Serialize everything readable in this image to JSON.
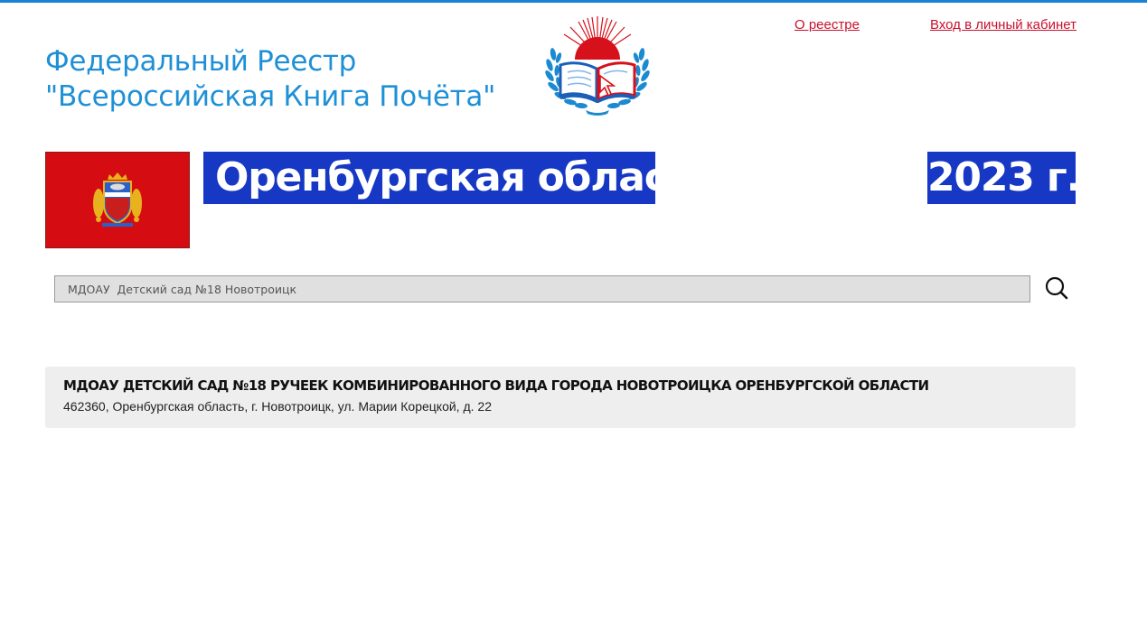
{
  "header": {
    "title_line1": "Федеральный Реестр",
    "title_line2": "\"Всероссийская Книга Почёта\"",
    "nav": {
      "about_label": "О реестре",
      "login_label": "Вход в личный кабинет"
    },
    "logo_icon": "book-of-honor-logo-icon"
  },
  "region": {
    "name": "Оренбургская область",
    "year": "2023 г.",
    "flag_icon": "orenburg-flag-icon"
  },
  "search": {
    "value": "МДОАУ  Детский сад №18 Новотроицк",
    "button_icon": "search-icon"
  },
  "results": [
    {
      "name": "МДОАУ ДЕТСКИЙ САД №18 РУЧЕЕК КОМБИНИРОВАННОГО ВИДА ГОРОДА НОВОТРОИЦКА ОРЕНБУРГСКОЙ ОБЛАСТИ",
      "address": "462360, Оренбургская область, г. Новотроицк, ул. Марии Корецкой, д. 22"
    }
  ],
  "colors": {
    "accent_blue": "#1e90d6",
    "banner_blue": "#1638c4",
    "link_red": "#c8102e",
    "flag_red": "#d50d12"
  }
}
